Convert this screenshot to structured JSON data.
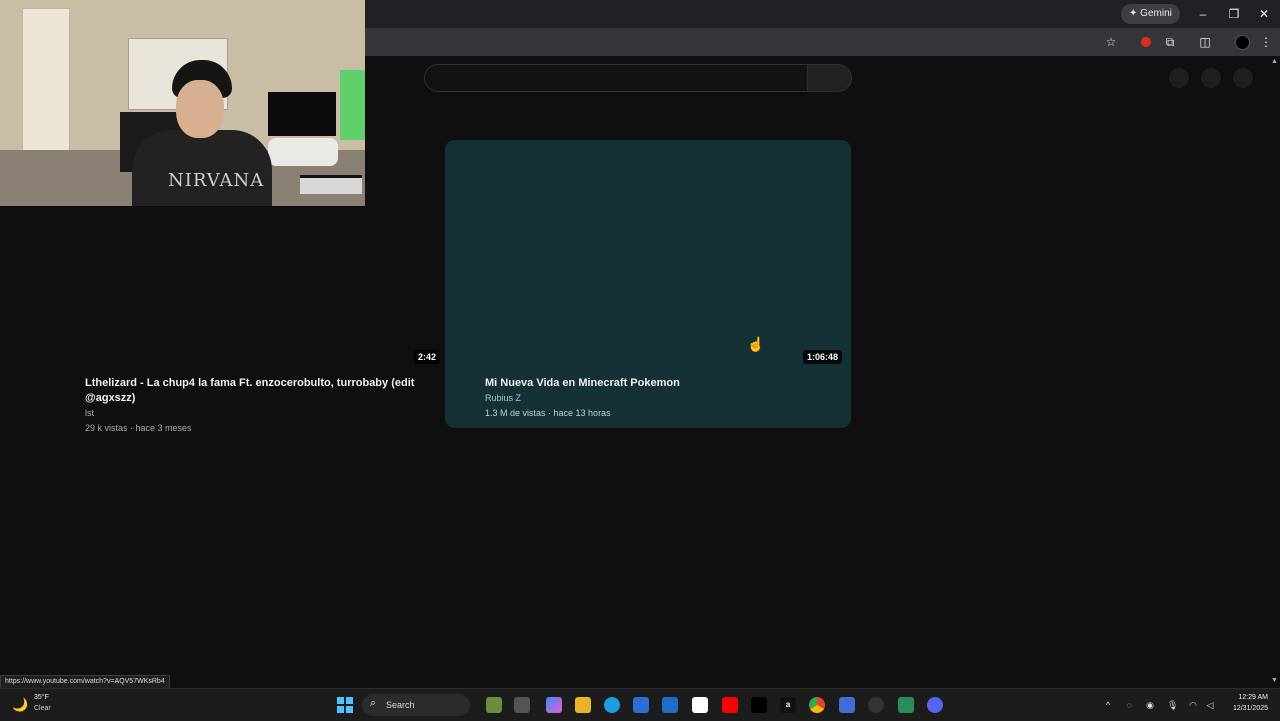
{
  "browser": {
    "gemini_label": "Gemini",
    "gemini_icon": "✦",
    "win_minimize": "–",
    "win_restore": "❐",
    "win_close": "✕",
    "toolbar_icons": {
      "bookmark": "☆",
      "extensions": "⧉",
      "sidepanel": "◫",
      "menu": "⋮"
    }
  },
  "results": [
    {
      "duration": "2:42",
      "title_line1": "Lthelizard - La chup4 la fama Ft. enzocerobulto, turrobaby (edit",
      "title_line2": "@agxszz)",
      "channel": "lst",
      "meta": "29 k vistas · hace 3 meses"
    },
    {
      "duration": "1:06:48",
      "title": "Mi Nueva Vida en Minecraft Pokemon",
      "channel": "Rubius Z",
      "meta": "1.3 M de vistas · hace 13 horas",
      "accent": "#163135"
    }
  ],
  "webcam": {
    "shirt_text": "NIRVANA"
  },
  "status_url": "https://www.youtube.com/watch?v=AQV57WKsRb4",
  "taskbar": {
    "weather_temp": "35°F",
    "weather_condition": "Clear",
    "search_label": "Search",
    "clock_time": "12:29 AM",
    "clock_date": "12/31/2025",
    "taskbar_icons": [
      "widgets-icon",
      "file-icon",
      "copilot-icon",
      "files-icon",
      "edge-icon",
      "store-icon",
      "outlook-icon",
      "capcut-icon",
      "youtube-icon",
      "netflix-icon",
      "amazon-icon",
      "chrome-icon",
      "app-icon",
      "obs-icon",
      "gamebar-icon",
      "discord-icon"
    ],
    "amazon_glyph": "a",
    "tray_chevron": "^"
  }
}
